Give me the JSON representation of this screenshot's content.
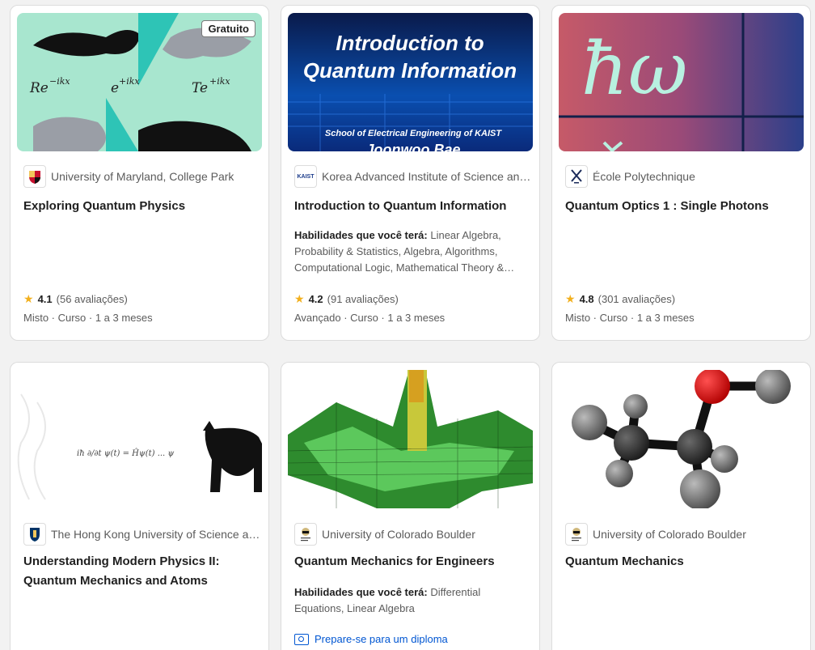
{
  "cards": [
    {
      "image_alt": "Exploring Quantum Physics",
      "badge": "Gratuito",
      "partner": "University of Maryland, College Park",
      "title": "Exploring Quantum Physics",
      "rating": "4.1",
      "reviews": "(56 avaliações)",
      "meta": "Misto · Curso · 1 a 3 meses",
      "thumb_text": [
        "Re",
        "−ikx",
        "e",
        "+ikx",
        "Te",
        "+ikx"
      ]
    },
    {
      "partner": "Korea Advanced Institute of Science and Technology(KAIST)",
      "title": "Introduction to Quantum Information",
      "skills_label": "Habilidades que você terá:",
      "skills": " Linear Algebra, Probability & Statistics, Algebra, Algorithms, Computational Logic, Mathematical Theory & Analysis",
      "rating": "4.2",
      "reviews": "(91 avaliações)",
      "meta": "Avançado · Curso · 1 a 3 meses",
      "thumb_text": [
        "Introduction to",
        "Quantum Information",
        "School of Electrical Engineering of KAIST",
        "Joonwoo Bae"
      ],
      "logo_text": "KAIST"
    },
    {
      "partner": "École Polytechnique",
      "title": "Quantum Optics 1 : Single Photons",
      "rating": "4.8",
      "reviews": "(301 avaliações)",
      "meta": "Misto · Curso · 1 a 3 meses",
      "thumb_text": [
        "ħω"
      ]
    },
    {
      "partner": "The Hong Kong University of Science and Technology",
      "title": "Understanding Modern Physics II: Quantum Mechanics and Atoms"
    },
    {
      "partner": "University of Colorado Boulder",
      "title": "Quantum Mechanics for Engineers",
      "skills_label": "Habilidades que você terá:",
      "skills": " Differential Equations, Linear Algebra",
      "degree": "Prepare-se para um diploma"
    },
    {
      "partner": "University of Colorado Boulder",
      "title": "Quantum Mechanics"
    }
  ],
  "colors": {
    "accent": "#0056d2",
    "star": "#f2b01e"
  }
}
